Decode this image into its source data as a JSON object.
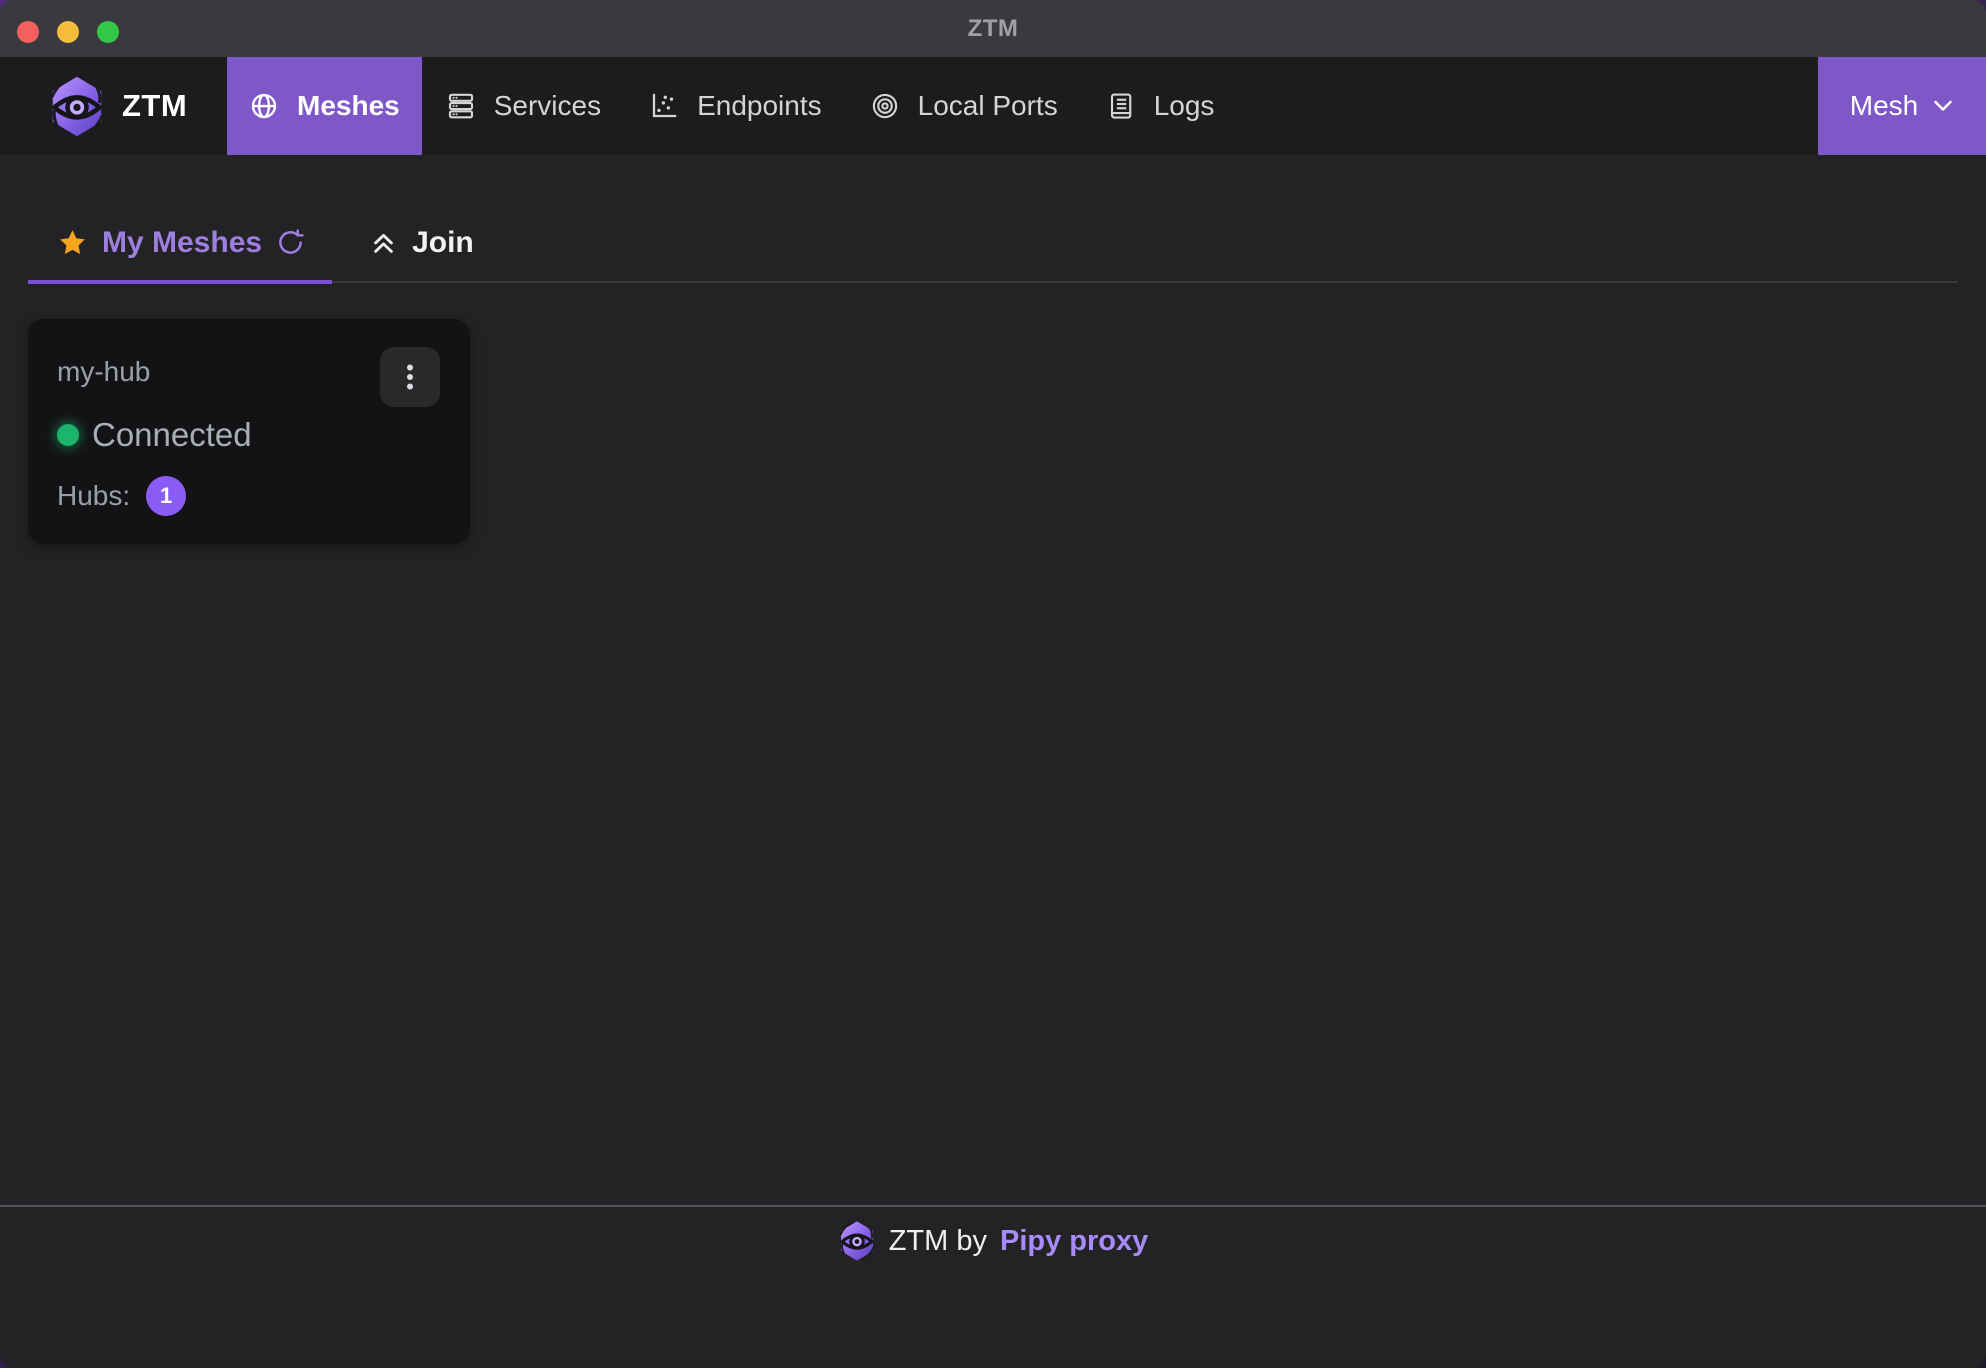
{
  "window": {
    "title": "ZTM"
  },
  "nav": {
    "brand": "ZTM",
    "items": [
      {
        "label": "Meshes",
        "icon": "globe-icon",
        "active": true
      },
      {
        "label": "Services",
        "icon": "server-icon",
        "active": false
      },
      {
        "label": "Endpoints",
        "icon": "chart-scatter-icon",
        "active": false
      },
      {
        "label": "Local Ports",
        "icon": "bullseye-icon",
        "active": false
      },
      {
        "label": "Logs",
        "icon": "book-icon",
        "active": false
      }
    ],
    "mesh_menu_label": "Mesh"
  },
  "tabs": {
    "my_meshes": "My Meshes",
    "join": "Join",
    "icons": [
      "star-icon",
      "refresh-icon",
      "angle-double-up-icon"
    ]
  },
  "mesh_card": {
    "name": "my-hub",
    "status": "Connected",
    "hubs_label": "Hubs:",
    "hubs_count": "1",
    "menu_icon": "ellipsis-vertical-icon"
  },
  "footer": {
    "byline": "ZTM by",
    "link": "Pipy proxy"
  },
  "colors": {
    "accent": "#7e57c8",
    "accent_bright": "#8a5cf6",
    "accent_text": "#9d7fe0",
    "tab_underline": "#7c4fd8",
    "star": "#f5a41d",
    "status_green": "#1db56b",
    "titlebar": "#3a393e",
    "navbar": "#1c1c1e",
    "surface": "#232325",
    "card_bg": "#131315"
  }
}
